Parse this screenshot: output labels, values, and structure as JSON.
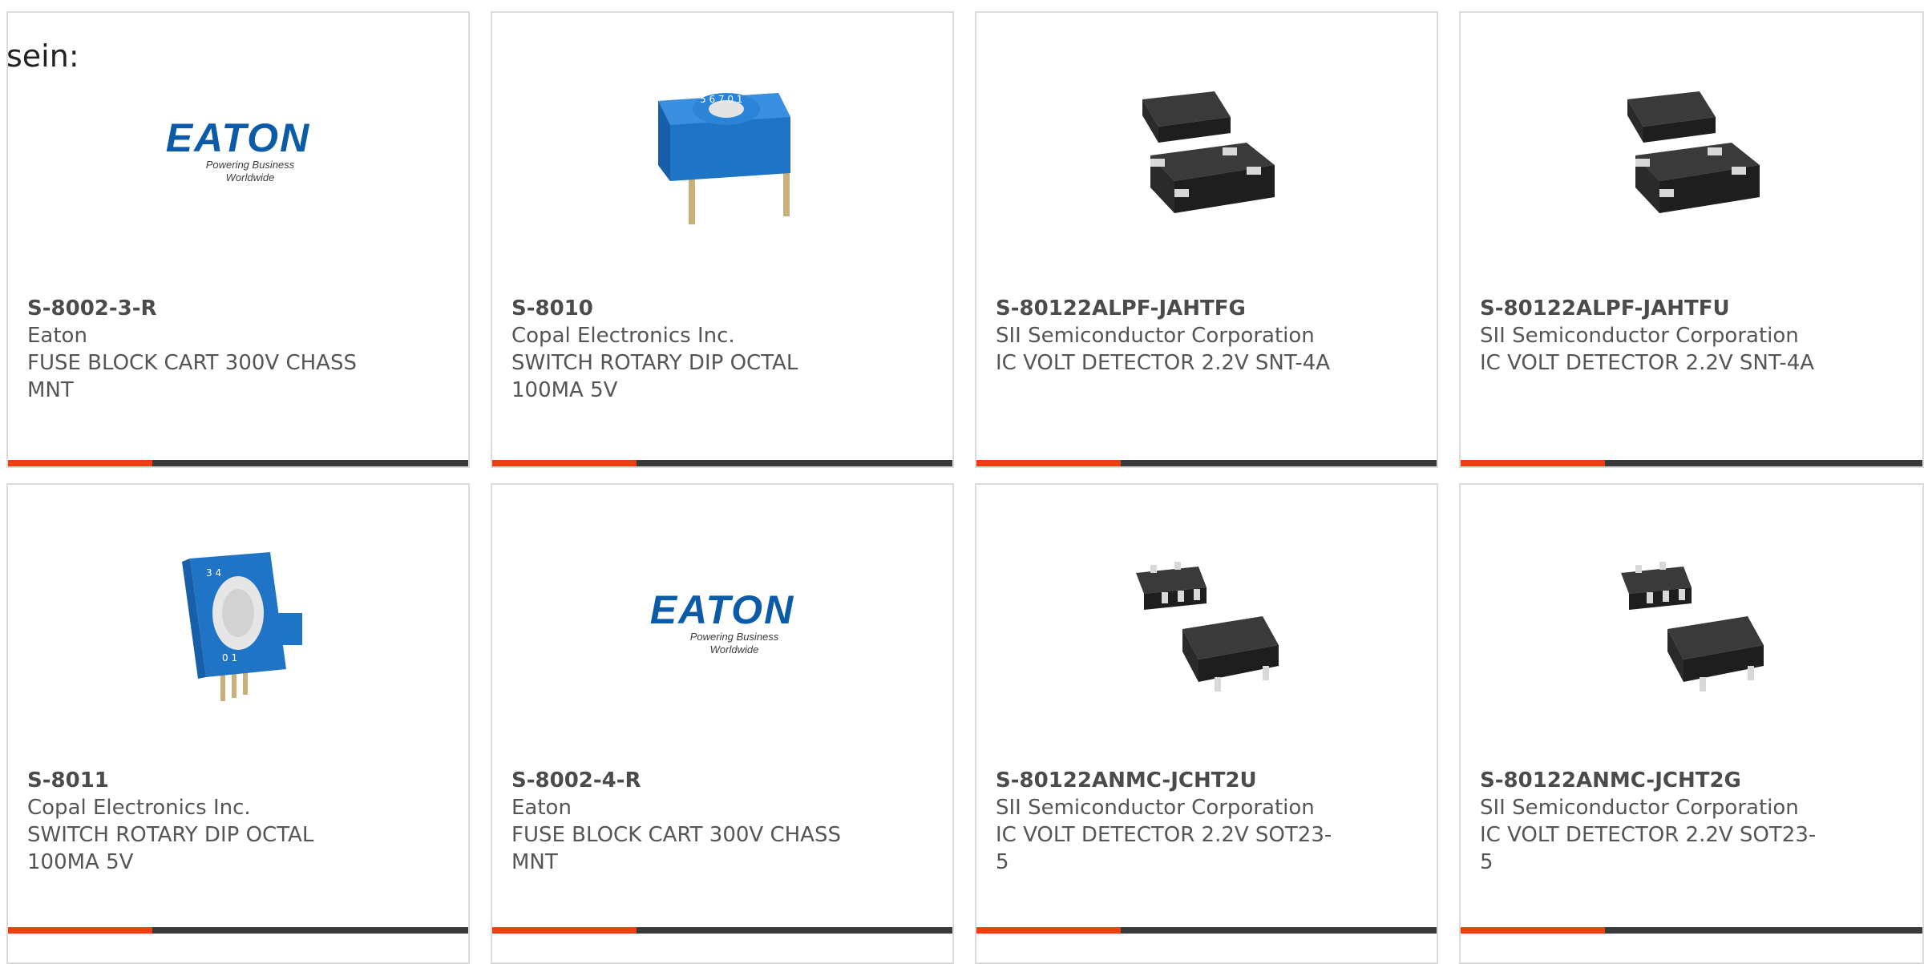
{
  "intro": "sein:",
  "colors": {
    "accent": "#e8410f",
    "bar": "#3a3a3a",
    "brand_eaton": "#0b5ba9"
  },
  "cards": [
    {
      "part": "S-8002-3-R",
      "maker": "Eaton",
      "desc1": "FUSE BLOCK CART 300V CHASS",
      "desc2": "MNT",
      "image": "eaton-logo",
      "logo_word": "EATON",
      "logo_tag": "Powering Business Worldwide"
    },
    {
      "part": "S-8010",
      "maker": "Copal Electronics Inc.",
      "desc1": "SWITCH ROTARY DIP OCTAL",
      "desc2": "100MA 5V",
      "image": "rotary-dip-switch"
    },
    {
      "part": "S-80122ALPF-JAHTFG",
      "maker": "SII Semiconductor Corporation",
      "desc1": "IC VOLT DETECTOR 2.2V SNT-4A",
      "desc2": "",
      "image": "snt-4a-package"
    },
    {
      "part": "S-80122ALPF-JAHTFU",
      "maker": "SII Semiconductor Corporation",
      "desc1": "IC VOLT DETECTOR 2.2V SNT-4A",
      "desc2": "",
      "image": "snt-4a-package"
    },
    {
      "part": "S-8011",
      "maker": "Copal Electronics Inc.",
      "desc1": "SWITCH ROTARY DIP OCTAL",
      "desc2": "100MA 5V",
      "image": "rotary-dip-switch-side"
    },
    {
      "part": "S-8002-4-R",
      "maker": "Eaton",
      "desc1": "FUSE BLOCK CART 300V CHASS",
      "desc2": "MNT",
      "image": "eaton-logo",
      "logo_word": "EATON",
      "logo_tag": "Powering Business Worldwide"
    },
    {
      "part": "S-80122ANMC-JCHT2U",
      "maker": "SII Semiconductor Corporation",
      "desc1": "IC VOLT DETECTOR 2.2V SOT23-",
      "desc2": "5",
      "image": "sot23-5-package"
    },
    {
      "part": "S-80122ANMC-JCHT2G",
      "maker": "SII Semiconductor Corporation",
      "desc1": "IC VOLT DETECTOR 2.2V SOT23-",
      "desc2": "5",
      "image": "sot23-5-package"
    }
  ]
}
